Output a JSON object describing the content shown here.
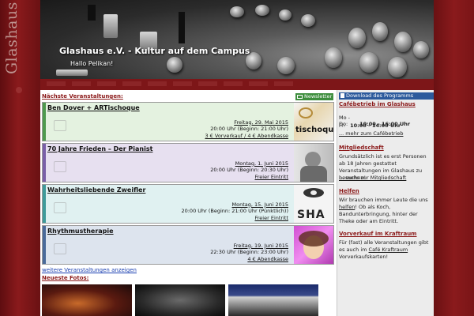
{
  "site": {
    "logo_text": "Glashaus",
    "title": "Glashaus e.V. - Kultur auf dem Campus",
    "greeting": "Hallo Pelikan!"
  },
  "main": {
    "events_heading": "Nächste Veranstaltungen:",
    "newsletter_label": "Newsletter",
    "events": [
      {
        "title": "Ben Dover + ARTischoque",
        "date": "Freitag, 29. Mai 2015",
        "time": "20:00 Uhr (Beginn: 21:00 Uhr)",
        "price": "3 € Vorverkauf / 4 € Abendkasse",
        "thumb_text": "tischoque",
        "bg": "#e4f2e0",
        "accent": "#4e9a4e"
      },
      {
        "title": "70 Jahre Frieden – Der Pianist",
        "date": "Montag, 1. Juni 2015",
        "time": "20:00 Uhr (Beginn: 20:30 Uhr)",
        "price": "Freier Eintritt",
        "thumb_text": "",
        "bg": "#e7e0f0",
        "accent": "#7a5fa8"
      },
      {
        "title": "Wahrheitsliebende Zweifler",
        "date": "Montag, 15. Juni 2015",
        "time": "20:00 Uhr (Beginn: 21:00 Uhr (Pünktlich))",
        "price": "Freier Eintritt",
        "thumb_text": "SHA",
        "bg": "#e0f1f1",
        "accent": "#3f9a9a"
      },
      {
        "title": "Rhythmustherapie",
        "date": "Freitag, 19. Juni 2015",
        "time": "22:30 Uhr (Beginn: 23:00 Uhr)",
        "price": "4 € Abendkasse",
        "thumb_text": "",
        "bg": "#dde4ee",
        "accent": "#4a6a9a"
      }
    ],
    "more_events_link": "weitere Veranstaltungen anzeigen",
    "photos_heading": "Neueste Fotos:"
  },
  "sidebar": {
    "download_label": "Download des Programms",
    "cafe": {
      "heading": "Cafébetrieb im Glashaus",
      "hours": [
        {
          "days": "Mo - Do:",
          "time": "10:00 - 16:00 Uhr"
        },
        {
          "days": "Fr:",
          "time": "10:00 - 14:00 Uhr"
        }
      ],
      "more_link": "... mehr zum Cafébetrieb"
    },
    "membership": {
      "heading": "Mitgliedschaft",
      "text": "Grundsätzlich ist es erst Personen ab 18 Jahren gestattet Veranstaltungen im Glashaus zu besuchen!",
      "more_link": "... mehr zur Mitgliedschaft"
    },
    "help": {
      "heading": "Helfen",
      "text_before": "Wir brauchen immer Leute die uns ",
      "link": "helfen",
      "text_after": "! Ob als Koch, Bandunterbringung, hinter der Theke oder am Eintritt."
    },
    "presale": {
      "heading": "Vorverkauf im Kraftraum",
      "text_before": "Für (fast) alle Veranstaltungen gibt es auch im ",
      "link": "Café Kraftraum",
      "text_after": " Vorverkaufskarten!"
    }
  }
}
